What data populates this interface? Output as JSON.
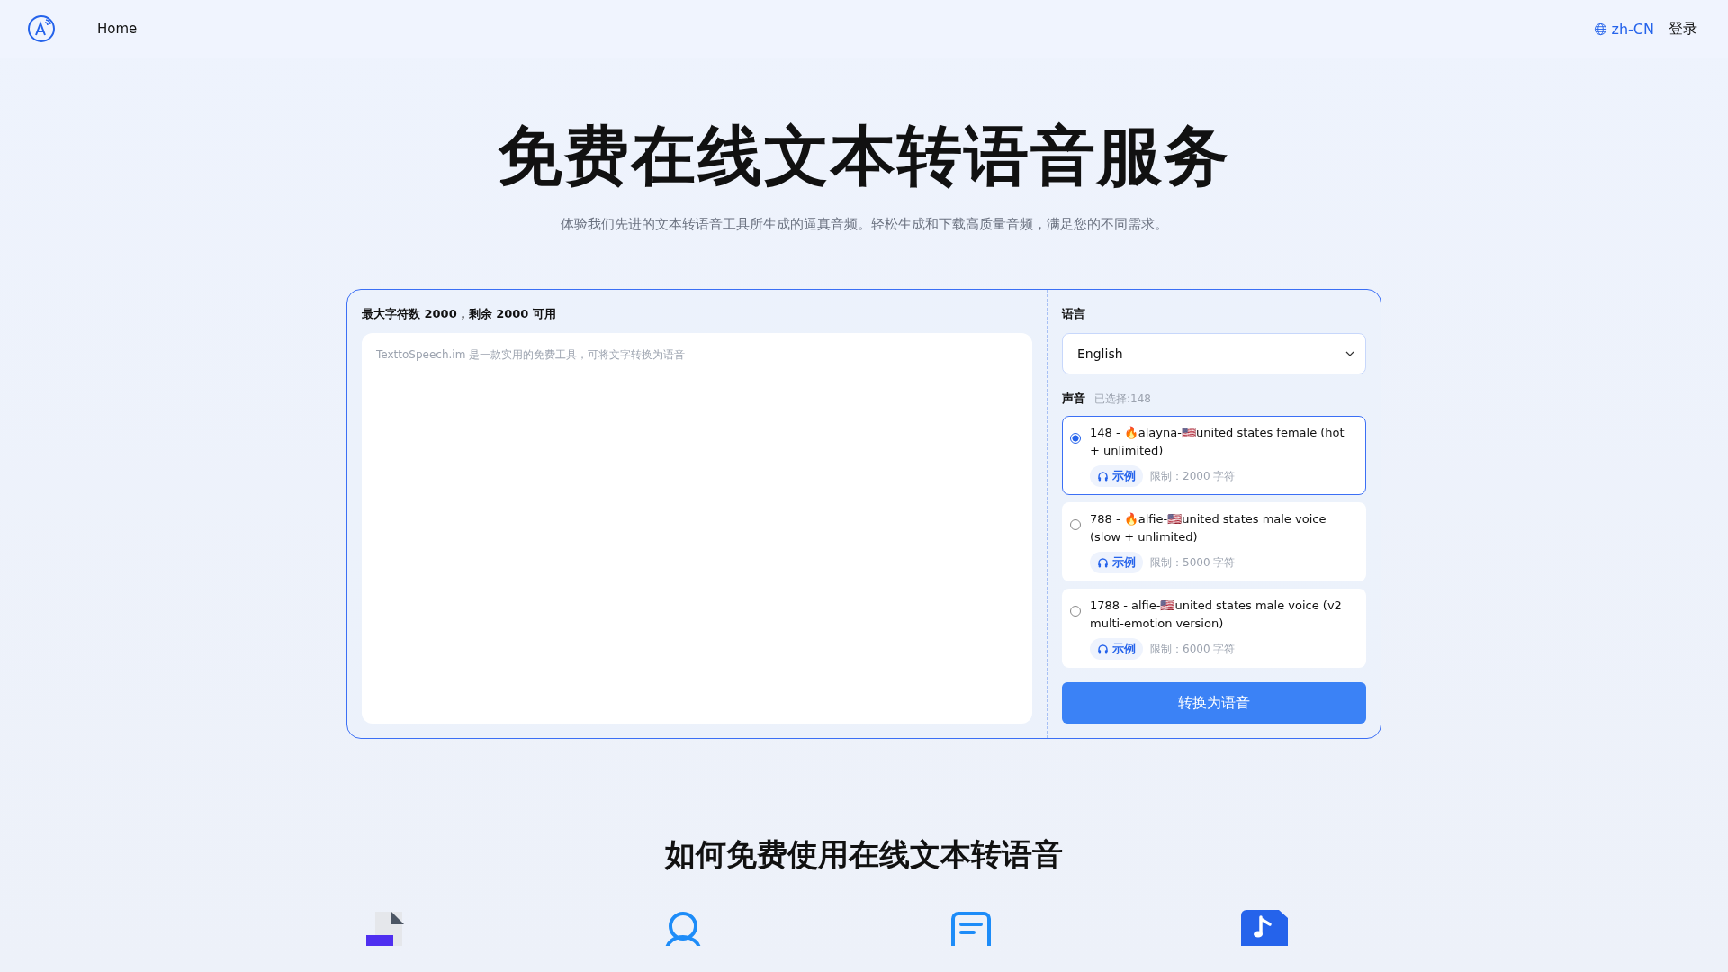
{
  "nav": {
    "home": "Home",
    "locale": "zh-CN",
    "login": "登录"
  },
  "hero": {
    "title": "免费在线文本转语音服务",
    "subtitle": "体验我们先进的文本转语音工具所生成的逼真音频。轻松生成和下载高质量音频，满足您的不同需求。"
  },
  "editor": {
    "limit_label": "最大字符数 2000，剩余 2000 可用",
    "placeholder": "TexttoSpeech.im 是一款实用的免费工具，可将文字转换为语音"
  },
  "settings": {
    "language_label": "语言",
    "language": "English",
    "voice_label": "声音",
    "voice_selected": "已选择:148",
    "voices": [
      {
        "name": "148 - 🔥alayna-🇺🇸united states female (hot + unlimited)",
        "sample": "示例",
        "limit": "限制：2000 字符",
        "selected": true
      },
      {
        "name": "788 - 🔥alfie-🇺🇸united states male voice (slow + unlimited)",
        "sample": "示例",
        "limit": "限制：5000 字符",
        "selected": false
      },
      {
        "name": "1788 - alfie-🇺🇸united states male voice (v2 multi-emotion version)",
        "sample": "示例",
        "limit": "限制：6000 字符",
        "selected": false
      }
    ],
    "convert_button": "转换为语音"
  },
  "how_to": {
    "title": "如何免费使用在线文本转语音",
    "steps": [
      {
        "kind": "dir"
      },
      {
        "kind": "person"
      },
      {
        "kind": "doc"
      },
      {
        "kind": "music"
      }
    ]
  }
}
